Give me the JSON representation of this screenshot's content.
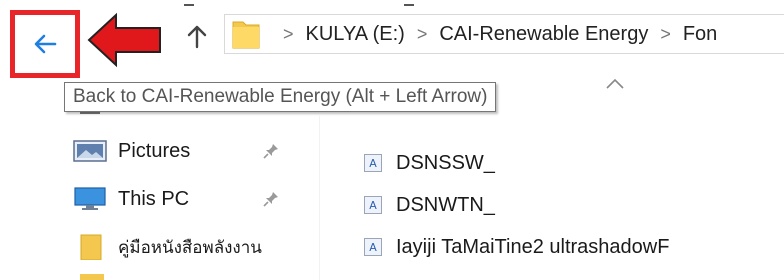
{
  "toolbar": {
    "breadcrumbs": [
      "KULYA (E:)",
      "CAI-Renewable Energy",
      "Fon"
    ],
    "separator": ">"
  },
  "tooltip": {
    "text": "Back to CAI-Renewable Energy (Alt + Left Arrow)"
  },
  "sidebar": {
    "items": [
      {
        "label": "Pictures",
        "icon": "pictures-icon",
        "pinned": true
      },
      {
        "label": "This PC",
        "icon": "this-pc-icon",
        "pinned": true
      },
      {
        "label": "คู่มือหนังสือพลังงาน",
        "icon": "folder-icon",
        "pinned": false
      }
    ]
  },
  "files": [
    {
      "name": "DSNSSW_",
      "icon": "font-file-icon"
    },
    {
      "name": "DSNWTN_",
      "icon": "font-file-icon"
    },
    {
      "name": "Iayiji TaMaiTine2 ultrashadowF",
      "icon": "font-file-icon"
    }
  ],
  "colors": {
    "highlight_box": "#e8262a",
    "back_arrow": "#1f7fe0",
    "folder": "#f4c84e"
  }
}
